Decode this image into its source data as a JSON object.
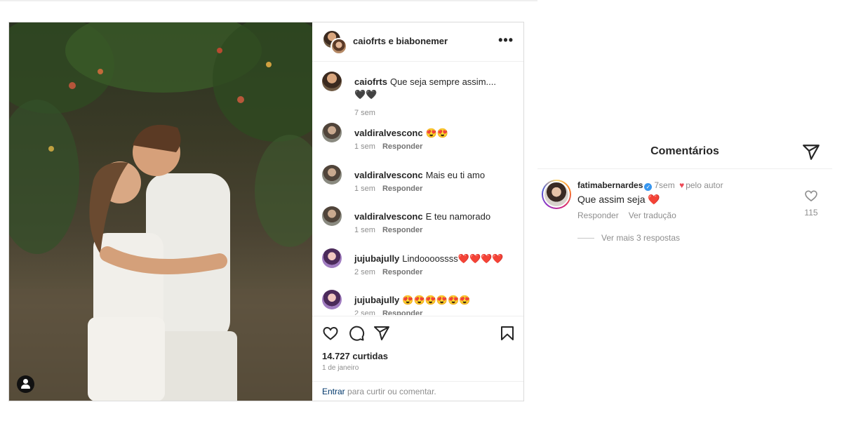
{
  "post": {
    "owners_label": "caiofrts e biabonemer",
    "more_options": "•••",
    "comments": [
      {
        "user": "caiofrts",
        "text": "Que seja sempre assim.... 🖤🖤",
        "time": "7 sem",
        "reply": ""
      },
      {
        "user": "valdiralvesconc",
        "text": "😍😍",
        "time": "1 sem",
        "reply": "Responder"
      },
      {
        "user": "valdiralvesconc",
        "text": "Mais eu ti amo",
        "time": "1 sem",
        "reply": "Responder"
      },
      {
        "user": "valdiralvesconc",
        "text": "E teu namorado",
        "time": "1 sem",
        "reply": "Responder"
      },
      {
        "user": "jujubajully",
        "text": "Lindoooossss❤️❤️❤️❤️",
        "time": "2 sem",
        "reply": "Responder"
      },
      {
        "user": "jujubajully",
        "text": "😍😍😍😍😍😍",
        "time": "2 sem",
        "reply": "Responder"
      }
    ],
    "likes": "14.727 curtidas",
    "date": "1 de janeiro",
    "login_link": "Entrar",
    "login_text": " para curtir ou comentar.",
    "icons": [
      "heart-icon",
      "comment-icon",
      "share-icon",
      "bookmark-icon",
      "user-tag-icon"
    ]
  },
  "sheet": {
    "title": "Comentários",
    "comment": {
      "user": "fatimabernardes",
      "verified_mark": "✓",
      "time": "7sem",
      "liked_heart": "♥",
      "liked_by": "pelo autor",
      "text": "Que assim seja ❤️",
      "reply": "Responder",
      "translate": "Ver tradução",
      "like_count": "115",
      "more_replies": "Ver mais 3 respostas"
    },
    "icons": [
      "send-icon",
      "heart-outline-icon"
    ]
  },
  "colors": {
    "link": "#00376b",
    "verified": "#3897f0",
    "heart": "#ed4956",
    "muted": "#8e8e8e"
  }
}
